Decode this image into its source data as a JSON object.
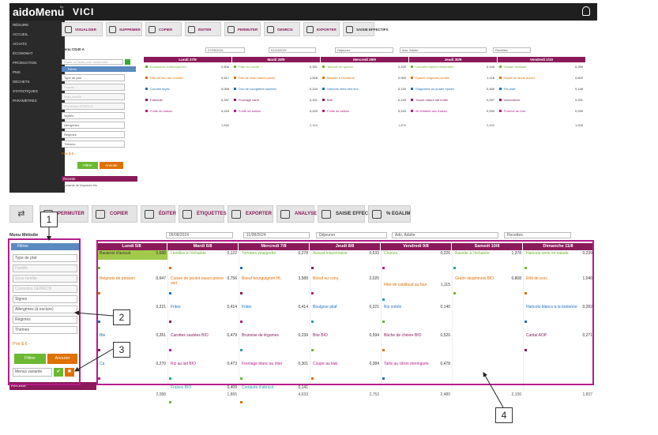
{
  "top": {
    "app_name": "aidoMenu",
    "app_sup": "by",
    "product": "VICI",
    "sidebar": [
      "RÉDUIRE",
      "ACCUEIL",
      "ACHATS",
      "ÉCONOMAT",
      "PRODUCTION",
      "PMS",
      "DÉCHETS",
      "STATISTIQUES",
      "PARAMÈTRES"
    ],
    "toolbar": [
      "VISUALISER",
      "SUPPRIMER",
      "COPIER",
      "ÉDITER",
      "PERMUTER",
      "GENRCN",
      "EXPORTER",
      "SAISIE EFFECTIFS"
    ],
    "menu_label": "Menu CD40 A",
    "date_from": "27/09/2021",
    "date_to": "01/10/2021",
    "meal": "Déjeuner",
    "audience": "Ado, Adulte",
    "type": "Recettes",
    "search_placeholder": "Entrer un texte pour rechercher",
    "filters_label": "Filtres",
    "filter_fields": [
      "Type de plat",
      "Famille",
      "Sous-famille",
      "Contextes GEMRCN",
      "Signes",
      "Allergènes",
      "Régimes",
      "Thèmes"
    ],
    "price_label": "Prix $ € -",
    "filter_btn": "Filtrer",
    "cancel_btn": "Annuler",
    "recipe_label": "Recette",
    "recipe_item": "Achards de légumes bio",
    "days": [
      "Lundi 27/9",
      "Mardi 28/9",
      "Mercredi 29/9",
      "Jeudi 30/9",
      "Vendredi 1/10"
    ],
    "rows": [
      [
        [
          "Ecalopines d'artichaut bot",
          "0,406"
        ],
        [
          "Pâté en croûte",
          "0,331"
        ],
        [
          "Taboulé de quinoa",
          "0,220"
        ],
        [
          "Carottes râpées citronnées",
          "0,149"
        ],
        [
          "Salade fantaisie",
          "0,259"
        ]
      ],
      [
        [
          "Filet de lieu aux moules",
          "0,617"
        ],
        [
          "Rôti de veau sauce poivre",
          "1,526"
        ],
        [
          "Bavette à l'échalote",
          "0,959"
        ],
        [
          "Epaule d'agneau confite",
          "1,116"
        ],
        [
          "Sauté de dinde aurore",
          "0,620"
        ]
      ],
      [
        [
          "Coudes rayés",
          "0,065"
        ],
        [
          "Duo de courgettes sautées",
          "0,104"
        ],
        [
          "Haricots verts très fins",
          "0,130"
        ],
        [
          "Flageolets au quatre épices",
          "0,460"
        ],
        [
          "Riz pilaf",
          "0,148"
        ]
      ],
      [
        [
          "Faisselle",
          "0,337"
        ],
        [
          "Fromage carré",
          "0,151"
        ],
        [
          "Brie",
          "0,145"
        ],
        [
          "Yaourt nature lait entier",
          "0,097"
        ],
        [
          "Abondance",
          "0,331"
        ]
      ],
      [
        [
          "Fruits de saison",
          "0,243"
        ],
        [
          "Fruits de saison",
          "0,243"
        ],
        [
          "Fruits de saison",
          "0,243"
        ],
        [
          "Ile flottante aux fraises",
          "0,294"
        ],
        [
          "Pomme au four",
          "0,259"
        ]
      ]
    ],
    "totals": [
      "1,669",
      "2,323",
      "1,876",
      "2,403",
      "1,838"
    ]
  },
  "bottom": {
    "toolbar": [
      "PERMUTER",
      "COPIER",
      "ÉDITER",
      "ÉTIQUETTES",
      "EXPORTER",
      "ANALYSE",
      "SAISIE EFFECTIFS",
      "% EGALIM"
    ],
    "menu_label": "Menu Mélodie",
    "date_from": "05/08/2024",
    "date_to": "11/08/2024",
    "meal": "Déjeuner",
    "audience": "Ado, Adulte",
    "type": "Recettes",
    "filters_label": "Filtres",
    "filter_fields": [
      "Type de plat",
      "Famille",
      "Sous-famille",
      "Contextes GEMRCN",
      "Signes",
      "Allergènes (à exclure)",
      "Régimes",
      "Thèmes"
    ],
    "price_label": "Prix $ € -",
    "filter_btn": "Filtrer",
    "cancel_btn": "Annuler",
    "variant_label": "Menus variante",
    "recipe_label": "Recette",
    "days": [
      "Lundi 5/8",
      "Mardi 6/8",
      "Mercredi 7/8",
      "Jeudi 8/8",
      "Vendredi 9/8",
      "Samedi 10/8",
      "Dimanche 11/8"
    ],
    "col0": [
      [
        "Bavarois d'avocat",
        "0,688"
      ],
      [
        "Beignets de poisson",
        "0,647"
      ],
      [
        "",
        "0,221"
      ],
      [
        "",
        "0,261"
      ],
      [
        "",
        "0,270"
      ]
    ],
    "col1": [
      [
        "Lentilles à l'échalote",
        "0,122"
      ],
      [
        "Cuisse de poulet sauce poivre vert",
        "0,756"
      ],
      [
        "Frites",
        "0,414"
      ],
      [
        "Carottes sautées BIO",
        "0,479"
      ],
      [
        "Riz au lait BIO",
        "0,473"
      ],
      [
        "Fraises BIO",
        "0,409"
      ]
    ],
    "col2": [
      [
        "Tomates vinaigrette",
        "0,278"
      ],
      [
        "Boeuf bourguignon HL",
        "3,588"
      ],
      [
        "Frites",
        "0,414"
      ],
      [
        "Brunoise de légumes",
        "0,239"
      ],
      [
        "Fromage blanc au miel",
        "0,301"
      ],
      [
        "Compote d'abricot",
        "0,141"
      ]
    ],
    "col3": [
      [
        "Avocat mayonnaise",
        "0,533"
      ],
      [
        "Boeuf au curry",
        "2,020"
      ],
      [
        "Boulgour pilaf",
        "0,221"
      ],
      [
        "Brie BIO",
        "0,594"
      ],
      [
        "Coupe au kiwi",
        "0,384"
      ]
    ],
    "col4": [
      [
        "Chorizo",
        "0,226"
      ],
      [
        "Filet de cabillaud au four",
        "1,115"
      ],
      [
        "Riz créole",
        "0,140"
      ],
      [
        "Bûche de chèvre BIO",
        "0,520"
      ],
      [
        "Tarte au citron meringuée",
        "0,478"
      ]
    ],
    "col5": [
      [
        "Bavette à l'échalote",
        "1,378"
      ],
      [
        "Gratin dauphinois BIO",
        "0,808"
      ]
    ],
    "col6": [
      [
        "Haricots verts en salade",
        "0,239"
      ],
      [
        "Rôti de porc",
        "1,046"
      ],
      [
        "Haricots blancs à la bretonne",
        "0,282"
      ],
      [
        "Cantal AOP",
        "0,271"
      ]
    ],
    "extra_left": [
      "Ble",
      "Ca"
    ],
    "totals": [
      "2,088",
      "1,865",
      "4,633",
      "2,753",
      "2,480",
      "2,106",
      "1,837"
    ]
  },
  "callouts": [
    "1",
    "2",
    "3",
    "4"
  ]
}
